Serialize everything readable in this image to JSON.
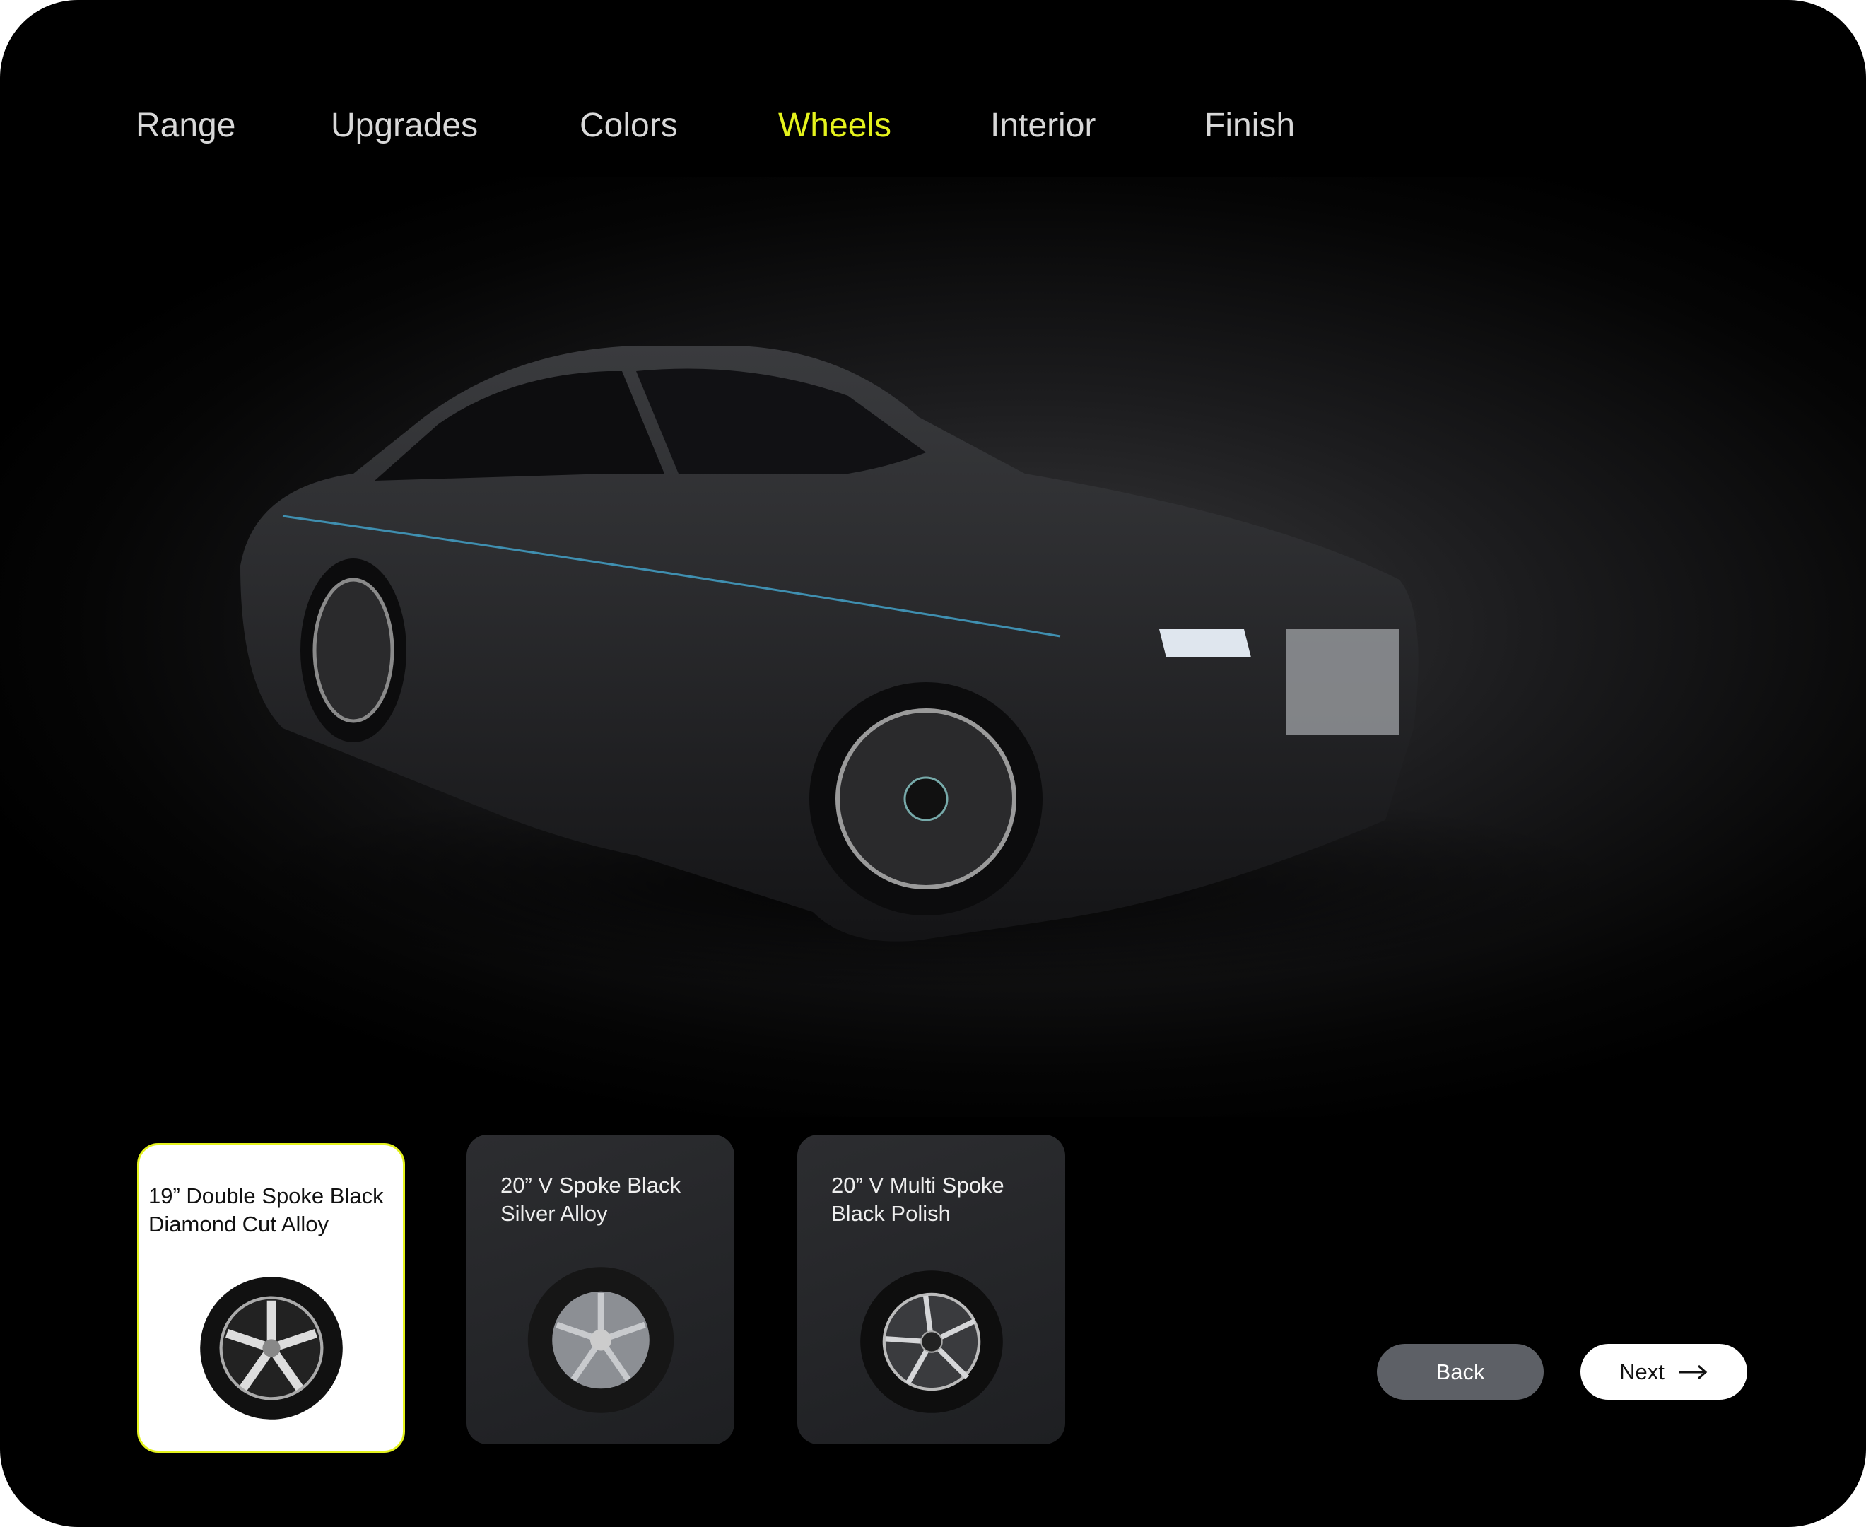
{
  "nav": {
    "items": [
      {
        "label": "Range"
      },
      {
        "label": "Upgrades"
      },
      {
        "label": "Colors"
      },
      {
        "label": "Wheels"
      },
      {
        "label": "Interior"
      },
      {
        "label": "Finish"
      }
    ],
    "active": "Wheels",
    "active_color": "#e4f21c"
  },
  "wheels": [
    {
      "name_line1": "19” Double Spoke Black",
      "name_line2": "Diamond Cut Alloy",
      "selected": true
    },
    {
      "name_line1": "20” V Spoke Black",
      "name_line2": "Silver Alloy",
      "selected": false
    },
    {
      "name_line1": "20” V Multi Spoke",
      "name_line2": "Black Polish",
      "selected": false
    }
  ],
  "actions": {
    "back_label": "Back",
    "next_label": "Next",
    "next_icon": "arrow-right-icon"
  }
}
